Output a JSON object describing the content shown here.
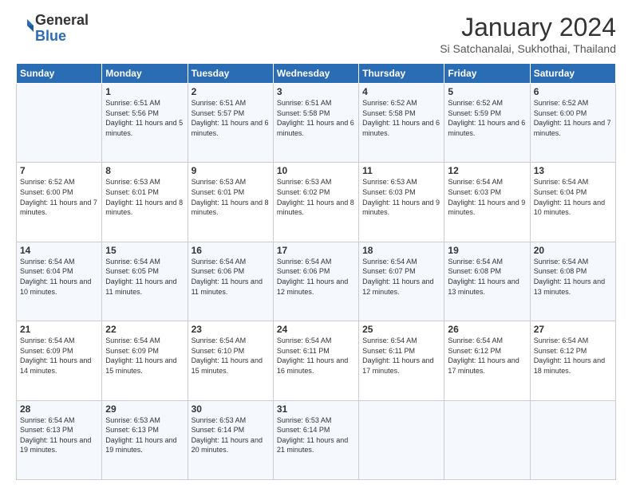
{
  "header": {
    "logo_general": "General",
    "logo_blue": "Blue",
    "month_title": "January 2024",
    "location": "Si Satchanalai, Sukhothai, Thailand"
  },
  "weekdays": [
    "Sunday",
    "Monday",
    "Tuesday",
    "Wednesday",
    "Thursday",
    "Friday",
    "Saturday"
  ],
  "weeks": [
    [
      {
        "num": "",
        "sunrise": "",
        "sunset": "",
        "daylight": "",
        "empty": true
      },
      {
        "num": "1",
        "sunrise": "Sunrise: 6:51 AM",
        "sunset": "Sunset: 5:56 PM",
        "daylight": "Daylight: 11 hours and 5 minutes."
      },
      {
        "num": "2",
        "sunrise": "Sunrise: 6:51 AM",
        "sunset": "Sunset: 5:57 PM",
        "daylight": "Daylight: 11 hours and 6 minutes."
      },
      {
        "num": "3",
        "sunrise": "Sunrise: 6:51 AM",
        "sunset": "Sunset: 5:58 PM",
        "daylight": "Daylight: 11 hours and 6 minutes."
      },
      {
        "num": "4",
        "sunrise": "Sunrise: 6:52 AM",
        "sunset": "Sunset: 5:58 PM",
        "daylight": "Daylight: 11 hours and 6 minutes."
      },
      {
        "num": "5",
        "sunrise": "Sunrise: 6:52 AM",
        "sunset": "Sunset: 5:59 PM",
        "daylight": "Daylight: 11 hours and 6 minutes."
      },
      {
        "num": "6",
        "sunrise": "Sunrise: 6:52 AM",
        "sunset": "Sunset: 6:00 PM",
        "daylight": "Daylight: 11 hours and 7 minutes."
      }
    ],
    [
      {
        "num": "7",
        "sunrise": "Sunrise: 6:52 AM",
        "sunset": "Sunset: 6:00 PM",
        "daylight": "Daylight: 11 hours and 7 minutes."
      },
      {
        "num": "8",
        "sunrise": "Sunrise: 6:53 AM",
        "sunset": "Sunset: 6:01 PM",
        "daylight": "Daylight: 11 hours and 8 minutes."
      },
      {
        "num": "9",
        "sunrise": "Sunrise: 6:53 AM",
        "sunset": "Sunset: 6:01 PM",
        "daylight": "Daylight: 11 hours and 8 minutes."
      },
      {
        "num": "10",
        "sunrise": "Sunrise: 6:53 AM",
        "sunset": "Sunset: 6:02 PM",
        "daylight": "Daylight: 11 hours and 8 minutes."
      },
      {
        "num": "11",
        "sunrise": "Sunrise: 6:53 AM",
        "sunset": "Sunset: 6:03 PM",
        "daylight": "Daylight: 11 hours and 9 minutes."
      },
      {
        "num": "12",
        "sunrise": "Sunrise: 6:54 AM",
        "sunset": "Sunset: 6:03 PM",
        "daylight": "Daylight: 11 hours and 9 minutes."
      },
      {
        "num": "13",
        "sunrise": "Sunrise: 6:54 AM",
        "sunset": "Sunset: 6:04 PM",
        "daylight": "Daylight: 11 hours and 10 minutes."
      }
    ],
    [
      {
        "num": "14",
        "sunrise": "Sunrise: 6:54 AM",
        "sunset": "Sunset: 6:04 PM",
        "daylight": "Daylight: 11 hours and 10 minutes."
      },
      {
        "num": "15",
        "sunrise": "Sunrise: 6:54 AM",
        "sunset": "Sunset: 6:05 PM",
        "daylight": "Daylight: 11 hours and 11 minutes."
      },
      {
        "num": "16",
        "sunrise": "Sunrise: 6:54 AM",
        "sunset": "Sunset: 6:06 PM",
        "daylight": "Daylight: 11 hours and 11 minutes."
      },
      {
        "num": "17",
        "sunrise": "Sunrise: 6:54 AM",
        "sunset": "Sunset: 6:06 PM",
        "daylight": "Daylight: 11 hours and 12 minutes."
      },
      {
        "num": "18",
        "sunrise": "Sunrise: 6:54 AM",
        "sunset": "Sunset: 6:07 PM",
        "daylight": "Daylight: 11 hours and 12 minutes."
      },
      {
        "num": "19",
        "sunrise": "Sunrise: 6:54 AM",
        "sunset": "Sunset: 6:08 PM",
        "daylight": "Daylight: 11 hours and 13 minutes."
      },
      {
        "num": "20",
        "sunrise": "Sunrise: 6:54 AM",
        "sunset": "Sunset: 6:08 PM",
        "daylight": "Daylight: 11 hours and 13 minutes."
      }
    ],
    [
      {
        "num": "21",
        "sunrise": "Sunrise: 6:54 AM",
        "sunset": "Sunset: 6:09 PM",
        "daylight": "Daylight: 11 hours and 14 minutes."
      },
      {
        "num": "22",
        "sunrise": "Sunrise: 6:54 AM",
        "sunset": "Sunset: 6:09 PM",
        "daylight": "Daylight: 11 hours and 15 minutes."
      },
      {
        "num": "23",
        "sunrise": "Sunrise: 6:54 AM",
        "sunset": "Sunset: 6:10 PM",
        "daylight": "Daylight: 11 hours and 15 minutes."
      },
      {
        "num": "24",
        "sunrise": "Sunrise: 6:54 AM",
        "sunset": "Sunset: 6:11 PM",
        "daylight": "Daylight: 11 hours and 16 minutes."
      },
      {
        "num": "25",
        "sunrise": "Sunrise: 6:54 AM",
        "sunset": "Sunset: 6:11 PM",
        "daylight": "Daylight: 11 hours and 17 minutes."
      },
      {
        "num": "26",
        "sunrise": "Sunrise: 6:54 AM",
        "sunset": "Sunset: 6:12 PM",
        "daylight": "Daylight: 11 hours and 17 minutes."
      },
      {
        "num": "27",
        "sunrise": "Sunrise: 6:54 AM",
        "sunset": "Sunset: 6:12 PM",
        "daylight": "Daylight: 11 hours and 18 minutes."
      }
    ],
    [
      {
        "num": "28",
        "sunrise": "Sunrise: 6:54 AM",
        "sunset": "Sunset: 6:13 PM",
        "daylight": "Daylight: 11 hours and 19 minutes."
      },
      {
        "num": "29",
        "sunrise": "Sunrise: 6:53 AM",
        "sunset": "Sunset: 6:13 PM",
        "daylight": "Daylight: 11 hours and 19 minutes."
      },
      {
        "num": "30",
        "sunrise": "Sunrise: 6:53 AM",
        "sunset": "Sunset: 6:14 PM",
        "daylight": "Daylight: 11 hours and 20 minutes."
      },
      {
        "num": "31",
        "sunrise": "Sunrise: 6:53 AM",
        "sunset": "Sunset: 6:14 PM",
        "daylight": "Daylight: 11 hours and 21 minutes."
      },
      {
        "num": "",
        "sunrise": "",
        "sunset": "",
        "daylight": "",
        "empty": true
      },
      {
        "num": "",
        "sunrise": "",
        "sunset": "",
        "daylight": "",
        "empty": true
      },
      {
        "num": "",
        "sunrise": "",
        "sunset": "",
        "daylight": "",
        "empty": true
      }
    ]
  ]
}
